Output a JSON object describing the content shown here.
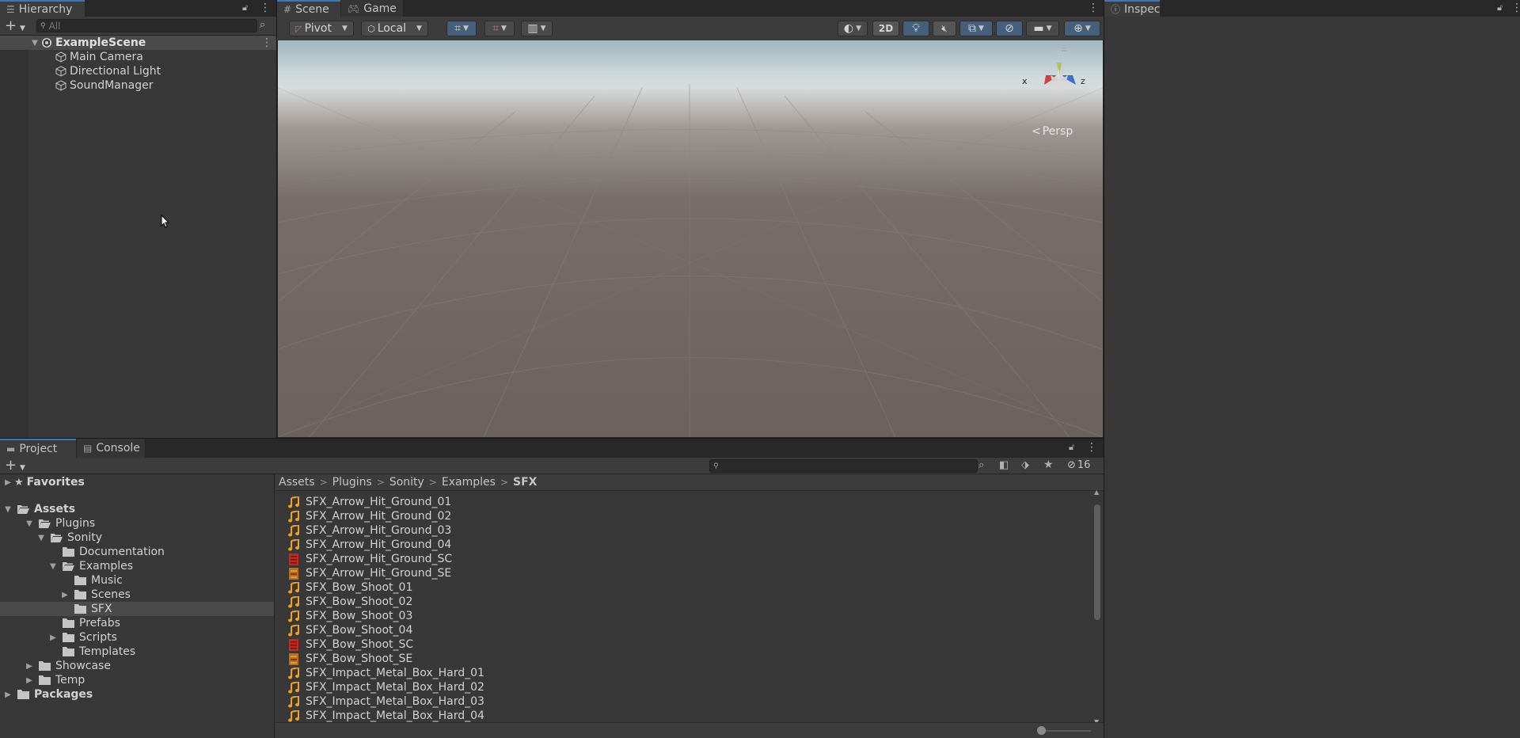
{
  "hierarchy": {
    "tab_label": "Hierarchy",
    "search_placeholder": "All",
    "scene_name": "ExampleScene",
    "items": [
      {
        "label": "Main Camera"
      },
      {
        "label": "Directional Light"
      },
      {
        "label": "SoundManager"
      }
    ]
  },
  "scene": {
    "tab_scene": "Scene",
    "tab_game": "Game",
    "pivot_label": "Pivot",
    "local_label": "Local",
    "mode_2d": "2D",
    "persp_label": "Persp",
    "gizmo_y": "y",
    "gizmo_x": "x",
    "gizmo_z": "z"
  },
  "inspector": {
    "tab_label": "Inspector"
  },
  "project": {
    "tab_project": "Project",
    "tab_console": "Console",
    "hidden_count": "16",
    "favorites_label": "Favorites",
    "assets_label": "Assets",
    "packages_label": "Packages",
    "tree": [
      {
        "label": "Plugins",
        "indent": 1,
        "open": true
      },
      {
        "label": "Sonity",
        "indent": 2,
        "open": true
      },
      {
        "label": "Documentation",
        "indent": 3
      },
      {
        "label": "Examples",
        "indent": 3,
        "open": true
      },
      {
        "label": "Music",
        "indent": 4
      },
      {
        "label": "Scenes",
        "indent": 4,
        "collapsed": true
      },
      {
        "label": "SFX",
        "indent": 4,
        "selected": true
      },
      {
        "label": "Prefabs",
        "indent": 3
      },
      {
        "label": "Scripts",
        "indent": 3,
        "collapsed": true
      },
      {
        "label": "Templates",
        "indent": 3
      },
      {
        "label": "Showcase",
        "indent": 1,
        "collapsed": true
      },
      {
        "label": "Temp",
        "indent": 1,
        "collapsed": true
      }
    ],
    "breadcrumb": [
      "Assets",
      "Plugins",
      "Sonity",
      "Examples",
      "SFX"
    ],
    "files": [
      {
        "name": "SFX_Arrow_Hit_Ground_01",
        "icon": "audio-clip-icon"
      },
      {
        "name": "SFX_Arrow_Hit_Ground_02",
        "icon": "audio-clip-icon"
      },
      {
        "name": "SFX_Arrow_Hit_Ground_03",
        "icon": "audio-clip-icon"
      },
      {
        "name": "SFX_Arrow_Hit_Ground_04",
        "icon": "audio-clip-icon"
      },
      {
        "name": "SFX_Arrow_Hit_Ground_SC",
        "icon": "sound-container-icon"
      },
      {
        "name": "SFX_Arrow_Hit_Ground_SE",
        "icon": "sound-event-icon"
      },
      {
        "name": "SFX_Bow_Shoot_01",
        "icon": "audio-clip-icon"
      },
      {
        "name": "SFX_Bow_Shoot_02",
        "icon": "audio-clip-icon"
      },
      {
        "name": "SFX_Bow_Shoot_03",
        "icon": "audio-clip-icon"
      },
      {
        "name": "SFX_Bow_Shoot_04",
        "icon": "audio-clip-icon"
      },
      {
        "name": "SFX_Bow_Shoot_SC",
        "icon": "sound-container-icon"
      },
      {
        "name": "SFX_Bow_Shoot_SE",
        "icon": "sound-event-icon"
      },
      {
        "name": "SFX_Impact_Metal_Box_Hard_01",
        "icon": "audio-clip-icon"
      },
      {
        "name": "SFX_Impact_Metal_Box_Hard_02",
        "icon": "audio-clip-icon"
      },
      {
        "name": "SFX_Impact_Metal_Box_Hard_03",
        "icon": "audio-clip-icon"
      },
      {
        "name": "SFX_Impact_Metal_Box_Hard_04",
        "icon": "audio-clip-icon"
      }
    ]
  },
  "colors": {
    "selection_accent": "#3a79bb",
    "audio_icon": "#f0a21a",
    "sc_icon": "#c8271e",
    "se_icon": "#c26d14"
  }
}
